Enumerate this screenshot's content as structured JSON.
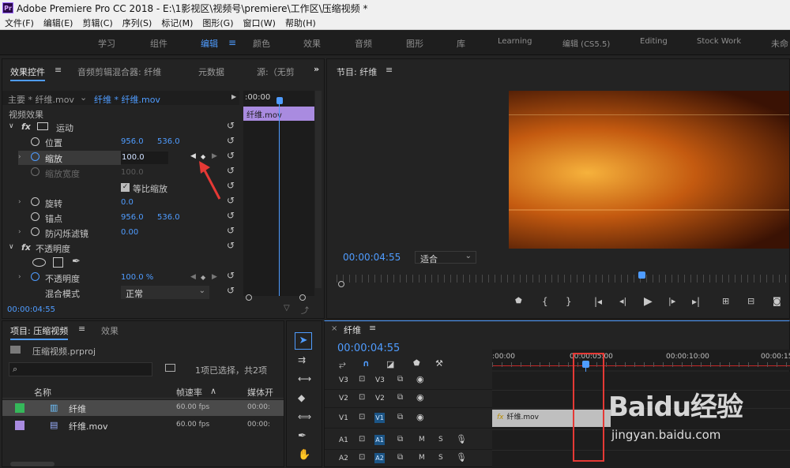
{
  "app": {
    "title": "Adobe Premiere Pro CC 2018 - E:\\1影视区\\视频号\\premiere\\工作区\\压缩视频 *",
    "badge": "Pr"
  },
  "menu": [
    "文件(F)",
    "编辑(E)",
    "剪辑(C)",
    "序列(S)",
    "标记(M)",
    "图形(G)",
    "窗口(W)",
    "帮助(H)"
  ],
  "workspaces": [
    "学习",
    "组件",
    "编辑",
    "颜色",
    "效果",
    "音频",
    "图形",
    "库",
    "Learning",
    "编辑 (CS5.5)",
    "Editing",
    "Stock Work",
    "未命"
  ],
  "effect_controls": {
    "tabs": [
      "效果控件",
      "音频剪辑混合器: 纤维",
      "元数据",
      "源:（无剪"
    ],
    "master": "主要 * 纤维.mov",
    "clip": "纤维 * 纤维.mov",
    "section_video": "视频效果",
    "timecode_ruler": ":00:00",
    "clip_bar": "纤维.mov",
    "motion": "运动",
    "position": {
      "label": "位置",
      "x": "956.0",
      "y": "536.0"
    },
    "scale": {
      "label": "缩放",
      "value": "100.0"
    },
    "scale_width": {
      "label": "缩放宽度",
      "value": "100.0"
    },
    "uniform_scale": "等比缩放",
    "rotation": {
      "label": "旋转",
      "value": "0.0"
    },
    "anchor": {
      "label": "锚点",
      "x": "956.0",
      "y": "536.0"
    },
    "antiflicker": {
      "label": "防闪烁滤镜",
      "value": "0.00"
    },
    "opacity_section": "不透明度",
    "opacity": {
      "label": "不透明度",
      "value": "100.0 %"
    },
    "blend": {
      "label": "混合模式",
      "value": "正常"
    },
    "timecode": "00:00:04:55"
  },
  "program": {
    "title": "节目: 纤维",
    "timecode": "00:00:04:55",
    "fit": "适合",
    "frame_colors": {
      "bright": "#f6b23c",
      "mid": "#c45a10",
      "dark": "#3a1204"
    }
  },
  "project": {
    "tabs": [
      "项目: 压缩视频",
      "效果"
    ],
    "file": "压缩视频.prproj",
    "selection_info": "1项已选择，共2项",
    "columns": [
      "名称",
      "帧速率",
      "媒体开"
    ],
    "items": [
      {
        "name": "纤维",
        "fps": "60.00 fps",
        "start": "00:00:",
        "color": "#35b85a",
        "icon": "sequence-icon"
      },
      {
        "name": "纤维.mov",
        "fps": "60.00 fps",
        "start": "00:00:",
        "color": "#a98be0",
        "icon": "clip-icon"
      }
    ]
  },
  "timeline": {
    "title": "纤维",
    "timecode": "00:00:04:55",
    "ruler": [
      ":00:00",
      "00:00:05:00",
      "00:00:10:00",
      "00:00:15"
    ],
    "tracks": [
      {
        "src": "V3",
        "tgt": "V3",
        "kind": "video"
      },
      {
        "src": "V2",
        "tgt": "V2",
        "kind": "video"
      },
      {
        "src": "V1",
        "tgt": "V1",
        "kind": "video"
      },
      {
        "src": "A1",
        "tgt": "A1",
        "kind": "audio"
      },
      {
        "src": "A2",
        "tgt": "A2",
        "kind": "audio"
      }
    ],
    "clip": "纤维.mov",
    "solo": "S",
    "mute": "M"
  },
  "watermark": {
    "brand": "Baidu经验",
    "url": "jingyan.baidu.com"
  },
  "colors": {
    "accent": "#4f9cff",
    "annotation": "#e53935",
    "clip_purple": "#a98be0"
  }
}
